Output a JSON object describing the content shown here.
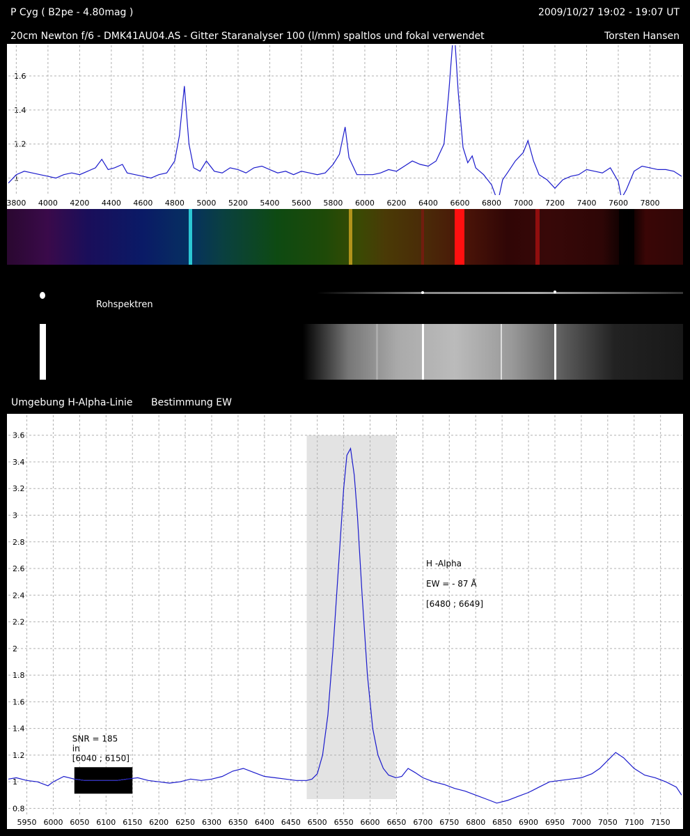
{
  "header": {
    "object": "P Cyg ( B2pe - 4.80mag )",
    "datetime": "2009/10/27   19:02 - 19:07 UT",
    "setup": "20cm Newton f/6 - DMK41AU04.AS - Gitter Staranalyser 100 (l/mm) spaltlos und fokal verwendet",
    "author": "Torsten Hansen"
  },
  "labels": {
    "raw_spectra": "Rohspektren",
    "halpha_section": "Umgebung H-Alpha-Linie",
    "ew_section": "Bestimmung  EW"
  },
  "colors": {
    "line": "#1a1acc",
    "grid": "#b0b0b0",
    "shade": "#e3e3e3",
    "snr_box": "#000000",
    "snr_trace": "#e8e060"
  },
  "chart_data": [
    {
      "type": "line",
      "title": "",
      "xlabel": "",
      "ylabel": "",
      "xlim": [
        3750,
        8000
      ],
      "ylim": [
        0.9,
        1.78
      ],
      "x_ticks": [
        "3800",
        "4000",
        "4200",
        "4400",
        "4600",
        "4800",
        "5000",
        "5200",
        "5400",
        "5600",
        "5800",
        "6000",
        "6200",
        "6400",
        "6600",
        "6800",
        "7000",
        "7200",
        "7400",
        "7600",
        "7800"
      ],
      "y_ticks": [
        "1",
        "1.2",
        "1.4",
        "1.6"
      ],
      "grid": true,
      "series": [
        {
          "x": [
            3750,
            3800,
            3850,
            3900,
            3950,
            4000,
            4050,
            4100,
            4150,
            4200,
            4250,
            4300,
            4340,
            4380,
            4420,
            4470,
            4500,
            4550,
            4600,
            4650,
            4700,
            4750,
            4800,
            4830,
            4861,
            4890,
            4920,
            4960,
            5000,
            5050,
            5100,
            5150,
            5200,
            5250,
            5300,
            5350,
            5400,
            5450,
            5500,
            5550,
            5600,
            5650,
            5700,
            5750,
            5800,
            5840,
            5876,
            5900,
            5950,
            6000,
            6050,
            6100,
            6150,
            6200,
            6250,
            6300,
            6350,
            6400,
            6450,
            6500,
            6530,
            6563,
            6590,
            6620,
            6650,
            6678,
            6700,
            6750,
            6800,
            6840,
            6870,
            6900,
            6950,
            7000,
            7030,
            7065,
            7100,
            7150,
            7200,
            7250,
            7300,
            7350,
            7400,
            7450,
            7500,
            7550,
            7600,
            7620,
            7650,
            7700,
            7750,
            7800,
            7850,
            7900,
            7950,
            8000
          ],
          "y": [
            0.97,
            1.02,
            1.04,
            1.03,
            1.02,
            1.01,
            1.0,
            1.02,
            1.03,
            1.02,
            1.04,
            1.06,
            1.11,
            1.05,
            1.06,
            1.08,
            1.03,
            1.02,
            1.01,
            1.0,
            1.02,
            1.03,
            1.1,
            1.25,
            1.54,
            1.2,
            1.06,
            1.04,
            1.1,
            1.04,
            1.03,
            1.06,
            1.05,
            1.03,
            1.06,
            1.07,
            1.05,
            1.03,
            1.04,
            1.02,
            1.04,
            1.03,
            1.02,
            1.03,
            1.08,
            1.14,
            1.3,
            1.12,
            1.02,
            1.02,
            1.02,
            1.03,
            1.05,
            1.04,
            1.07,
            1.1,
            1.08,
            1.07,
            1.1,
            1.2,
            1.5,
            1.9,
            1.5,
            1.18,
            1.09,
            1.13,
            1.06,
            1.02,
            0.96,
            0.86,
            0.99,
            1.03,
            1.1,
            1.15,
            1.22,
            1.1,
            1.02,
            0.99,
            0.94,
            0.99,
            1.01,
            1.02,
            1.05,
            1.04,
            1.03,
            1.06,
            0.98,
            0.88,
            0.93,
            1.04,
            1.07,
            1.06,
            1.05,
            1.05,
            1.04,
            1.01
          ]
        }
      ]
    },
    {
      "type": "line",
      "title": "",
      "xlabel": "",
      "ylabel": "",
      "xlim": [
        5915,
        7190
      ],
      "ylim": [
        0.75,
        3.75
      ],
      "x_ticks": [
        "5950",
        "6000",
        "6050",
        "6100",
        "6150",
        "6200",
        "6250",
        "6300",
        "6350",
        "6400",
        "6450",
        "6500",
        "6550",
        "6600",
        "6650",
        "6700",
        "6750",
        "6800",
        "6850",
        "6900",
        "6950",
        "7000",
        "7050",
        "7100",
        "7150"
      ],
      "y_ticks": [
        "0.8",
        "1",
        "1.2",
        "1.4",
        "1.6",
        "1.8",
        "2",
        "2.2",
        "2.4",
        "2.6",
        "2.8",
        "3",
        "3.2",
        "3.4",
        "3.6"
      ],
      "grid": true,
      "shaded_range": [
        6480,
        6649
      ],
      "shaded_ylim": [
        0.87,
        3.6
      ],
      "snr_range": [
        6040,
        6150
      ],
      "annotation": {
        "line1": "H -Alpha",
        "line2": "EW = - 87 Å",
        "line3": "[6480 ; 6649]"
      },
      "snr_annotation": {
        "line1": "SNR = 185",
        "line2": "in",
        "line3": "[6040 ; 6150]"
      },
      "series": [
        {
          "x": [
            5915,
            5930,
            5950,
            5970,
            5990,
            6000,
            6020,
            6040,
            6060,
            6080,
            6100,
            6120,
            6140,
            6160,
            6180,
            6200,
            6220,
            6240,
            6260,
            6280,
            6300,
            6320,
            6340,
            6360,
            6380,
            6400,
            6420,
            6440,
            6460,
            6480,
            6490,
            6500,
            6510,
            6520,
            6530,
            6540,
            6550,
            6556,
            6563,
            6570,
            6576,
            6585,
            6595,
            6605,
            6615,
            6625,
            6635,
            6649,
            6660,
            6672,
            6685,
            6700,
            6720,
            6740,
            6760,
            6780,
            6800,
            6820,
            6840,
            6860,
            6880,
            6900,
            6920,
            6940,
            6960,
            6980,
            7000,
            7020,
            7035,
            7050,
            7065,
            7080,
            7100,
            7120,
            7140,
            7160,
            7180,
            7190
          ],
          "y": [
            1.02,
            1.03,
            1.01,
            1.0,
            0.97,
            1.0,
            1.04,
            1.02,
            1.01,
            1.01,
            1.01,
            1.01,
            1.02,
            1.03,
            1.01,
            1.0,
            0.99,
            1.0,
            1.02,
            1.01,
            1.02,
            1.04,
            1.08,
            1.1,
            1.07,
            1.04,
            1.03,
            1.02,
            1.01,
            1.01,
            1.02,
            1.06,
            1.2,
            1.5,
            2.0,
            2.6,
            3.2,
            3.45,
            3.5,
            3.3,
            3.0,
            2.4,
            1.8,
            1.4,
            1.2,
            1.1,
            1.05,
            1.03,
            1.04,
            1.1,
            1.07,
            1.03,
            1.0,
            0.98,
            0.95,
            0.93,
            0.9,
            0.87,
            0.84,
            0.86,
            0.89,
            0.92,
            0.96,
            1.0,
            1.01,
            1.02,
            1.03,
            1.06,
            1.1,
            1.16,
            1.22,
            1.18,
            1.1,
            1.05,
            1.03,
            1.0,
            0.96,
            0.9
          ]
        }
      ]
    }
  ]
}
